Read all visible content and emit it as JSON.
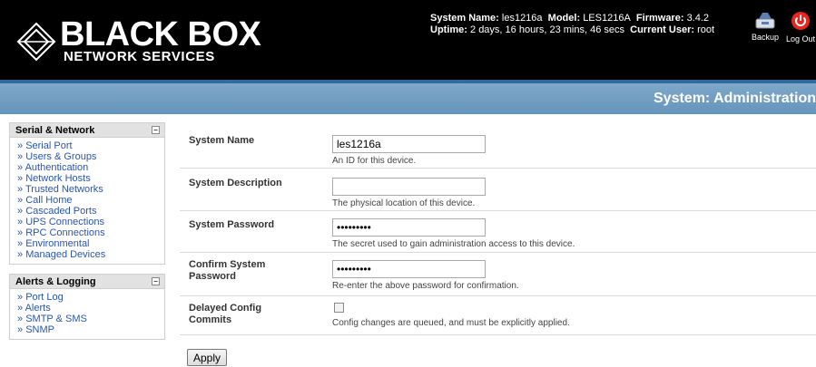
{
  "brand": {
    "logo_main": "BLACK BOX",
    "logo_sub": "NETWORK SERVICES"
  },
  "sysinfo": {
    "system_name_label": "System Name:",
    "system_name": "les1216a",
    "model_label": "Model:",
    "model": "LES1216A",
    "firmware_label": "Firmware:",
    "firmware": "3.4.2",
    "uptime_label": "Uptime:",
    "uptime": "2 days, 16 hours, 23 mins, 46 secs",
    "user_label": "Current User:",
    "user": "root"
  },
  "header_buttons": {
    "backup": "Backup",
    "logout": "Log Out"
  },
  "page_title": "System: Administration",
  "sidebar": {
    "serial_network": {
      "title": "Serial & Network",
      "items": [
        "Serial Port",
        "Users & Groups",
        "Authentication",
        "Network Hosts",
        "Trusted Networks",
        "Call Home",
        "Cascaded Ports",
        "UPS Connections",
        "RPC Connections",
        "Environmental",
        "Managed Devices"
      ]
    },
    "alerts_logging": {
      "title": "Alerts & Logging",
      "items": [
        "Port Log",
        "Alerts",
        "SMTP & SMS",
        "SNMP"
      ]
    },
    "collapse_symbol": "−"
  },
  "form": {
    "system_name": {
      "label": "System Name",
      "value": "les1216a",
      "hint": "An ID for this device."
    },
    "system_description": {
      "label": "System Description",
      "value": "",
      "hint": "The physical location of this device."
    },
    "system_password": {
      "label": "System Password",
      "value": "•••••••••",
      "hint": "The secret used to gain administration access to this device."
    },
    "confirm_password": {
      "label": "Confirm System Password",
      "value": "•••••••••",
      "hint": "Re-enter the above password for confirmation."
    },
    "delayed_commits": {
      "label": "Delayed Config Commits",
      "checked": false,
      "hint": "Config changes are queued, and must be explicitly applied."
    },
    "apply_label": "Apply"
  },
  "colors": {
    "header_bg": "#000000",
    "titlebar": "#6f9cc2",
    "link": "#2a56a8"
  }
}
